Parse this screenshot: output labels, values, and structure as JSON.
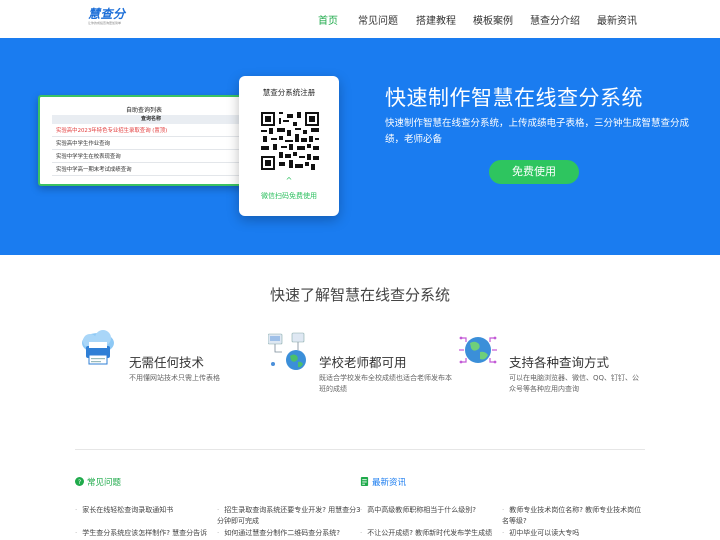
{
  "logo": {
    "text": "慧查分",
    "subtitle": "让你的成绩查询更加简单"
  },
  "nav": [
    "首页",
    "常见问题",
    "搭建教程",
    "模板案例",
    "慧查分介绍",
    "最新资讯"
  ],
  "colors": {
    "accent_green": "#1faa4b",
    "hero_blue": "#1a7cf0",
    "button_green": "#2ec55f"
  },
  "hero": {
    "list_card": {
      "title": "自助查询列表",
      "column": "查询名称",
      "rows": [
        {
          "name": "实验高中2023年特色专业招生录取查询 (置顶)",
          "action": "操",
          "highlight": true
        },
        {
          "name": "实验高中学生作业查询",
          "action": "操",
          "highlight": false
        },
        {
          "name": "实验中学学生在校表现查询",
          "action": "操",
          "highlight": false
        },
        {
          "name": "实验中学高一期末考试成绩查询",
          "action": "操",
          "highlight": false
        }
      ]
    },
    "qr_card": {
      "title": "慧查分系统注册",
      "arrow": "^",
      "hint": "微信扫码免费使用"
    },
    "title": "快速制作智慧在线查分系统",
    "description": "快速制作智慧在线查分系统，上传成绩电子表格，三分钟生成智慧查分成绩，老师必备",
    "button": "免费使用"
  },
  "intro": {
    "title": "快速了解智慧在线查分系统",
    "features": [
      {
        "title": "无需任何技术",
        "desc": "不用懂网站技术只需上传表格",
        "icon": "cloud-printer-icon"
      },
      {
        "title": "学校老师都可用",
        "desc": "既适合学校发布全校成绩也适合老师发布本班的成绩",
        "icon": "globe-network-icon"
      },
      {
        "title": "支持各种查询方式",
        "desc": "可以在电脑浏览器、微信、QQ、钉钉、公众号等各种应用内查询",
        "icon": "globe-circuit-icon"
      }
    ]
  },
  "faq": {
    "heading": "常见问题",
    "items": [
      "家长在线轻松查询录取通知书",
      "招生录取查询系统还要专业开发? 用慧查分3分钟即可完成",
      "学生查分系统应该怎样制作? 慧查分告诉",
      "如何通过慧查分制作二维码查分系统?"
    ]
  },
  "news": {
    "heading": "最新资讯",
    "items": [
      "高中高级教师职称相当于什么级别?",
      "教师专业技术岗位名称? 教师专业技术岗位名等级?",
      "不让公开成绩? 教师新时代发布学生成绩",
      "初中毕业可以读大专吗"
    ]
  }
}
